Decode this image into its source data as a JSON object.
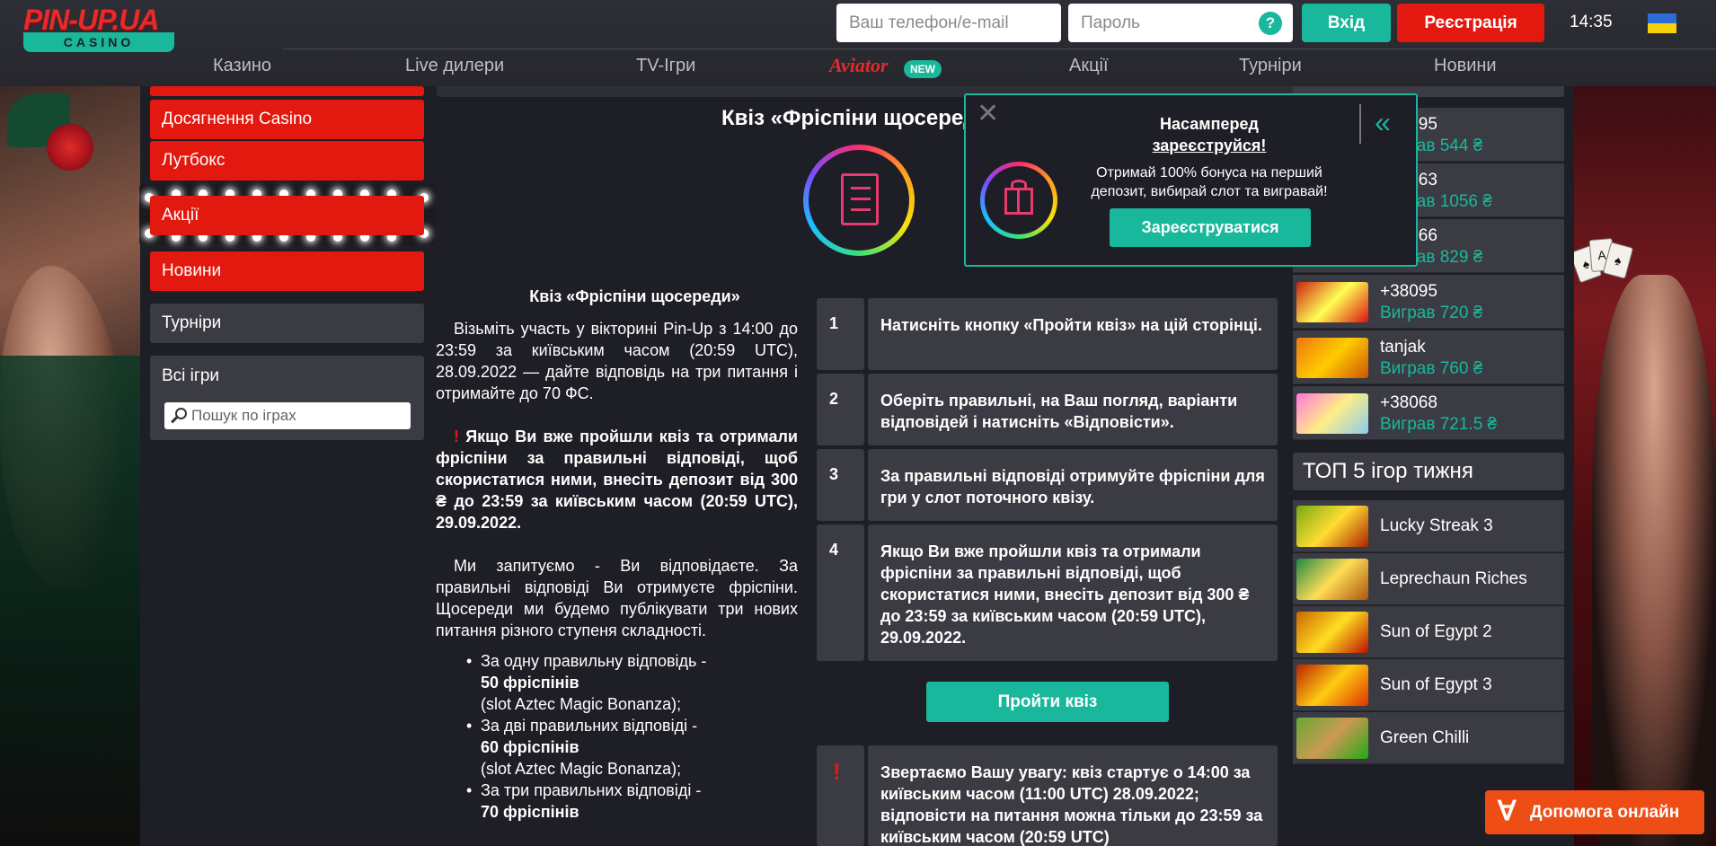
{
  "header": {
    "logo_text": "PIN-UP.UA",
    "logo_sub": "CASINO",
    "phone_placeholder": "Ваш телефон/e-mail",
    "password_placeholder": "Пароль",
    "help_glyph": "?",
    "login_label": "Вхід",
    "register_label": "Реєстрація",
    "time": "14:35",
    "flag": "ukraine-flag-icon"
  },
  "nav": {
    "items": [
      "Казино",
      "Live дилери",
      "TV-Ігри",
      "Aviator",
      "Акції",
      "Турніри",
      "Новини"
    ],
    "new_badge": "NEW"
  },
  "left_menu": {
    "items_red": [
      "Досягнення Casino",
      "Лутбокс",
      "Акції",
      "Новини"
    ],
    "items_gray": [
      "Турніри"
    ],
    "games_title": "Всі ігри",
    "search_placeholder": "Пошук по іграх"
  },
  "content": {
    "title": "Квіз «Фріспіни щосереди»",
    "heading": "Квіз «Фріспіни щосереди»",
    "p1": "Візьміть участь у вікторині Pin-Up з 14:00 до 23:59 за київським часом (20:59 UTC), 28.09.2022 — дайте відповідь на три питання і отримайте до 70 ФС.",
    "warn_mark": "!",
    "p2": "Якщо Ви вже пройшли квіз та отримали фріспіни за правильні відповіді, щоб скористатися ними, внесіть депозит від 300 ₴ до 23:59 за київським часом (20:59 UTC), 29.09.2022.",
    "p3": "Ми запитуємо - Ви відповідаєте. За правильні відповіді Ви отримуєте фріспіни. Щосереди ми будемо публікувати три нових питання різного ступеня складності.",
    "list": [
      {
        "line1": "За одну правильну відповідь -",
        "bold": "50 фріспінів",
        "line3": "(slot Aztec Magic Bonanza);"
      },
      {
        "line1": "За дві правильних відповіді -",
        "bold": "60 фріспінів",
        "line3": "(slot Aztec Magic Bonanza);"
      },
      {
        "line1": "За три правильних відповіді -",
        "bold": "70 фріспінів",
        "line3": ""
      }
    ],
    "steps": [
      {
        "num": "1",
        "text": "Натисніть кнопку «Пройти квіз» на цій сторінці."
      },
      {
        "num": "2",
        "text": "Оберіть правильні, на Ваш погляд, варіанти відповідей і натисніть «Відповісти»."
      },
      {
        "num": "3",
        "text": "За правильні відповіді отримуйте фріспіни для гри у слот поточного квізу."
      },
      {
        "num": "4",
        "text": "Якщо Ви вже пройшли квіз та отримали фріспіни за правильні відповіді, щоб скористатися ними, внесіть депозит від 300 ₴ до 23:59 за київським часом (20:59 UTC), 29.09.2022."
      }
    ],
    "quiz_button": "Пройти квіз",
    "notice_mark": "!",
    "notice": "Звертаємо Вашу увагу: квіз стартує о 14:00 за київським часом (11:00 UTC) 28.09.2022; відповісти на питання можна тільки до 23:59 за київським часом (20:59 UTC)"
  },
  "winners": [
    {
      "name": "+38095",
      "amount": "Виграв 544 ₴"
    },
    {
      "name": "+38063",
      "amount": "Виграв 1056 ₴"
    },
    {
      "name": "+38066",
      "amount": "Виграв 829 ₴"
    },
    {
      "name": "+38095",
      "amount": "Виграв 720 ₴"
    },
    {
      "name": "tanjak",
      "amount": "Виграв 760 ₴"
    },
    {
      "name": "+38068",
      "amount": "Виграв 721.5 ₴"
    }
  ],
  "top5": {
    "title": "ТОП 5 ігор тижня",
    "games": [
      "Lucky Streak 3",
      "Leprechaun Riches",
      "Sun of Egypt 2",
      "Sun of Egypt 3",
      "Green Chilli"
    ]
  },
  "popup": {
    "line1": "Насамперед",
    "line2": "зареєструйся!",
    "text": "Отримай 100% бонуса на перший депозит, вибирай слот та вигравай!",
    "button": "Зареєструватися",
    "close_glyph": "✕",
    "collapse_glyph": "«"
  },
  "help_online": {
    "label": "Допомога онлайн",
    "glyph": "∀"
  },
  "colors": {
    "accent": "#19b79b",
    "red": "#e3180e",
    "panel": "#3b3c43",
    "background": "#1e1f26",
    "help_orange": "#ef4d16"
  }
}
